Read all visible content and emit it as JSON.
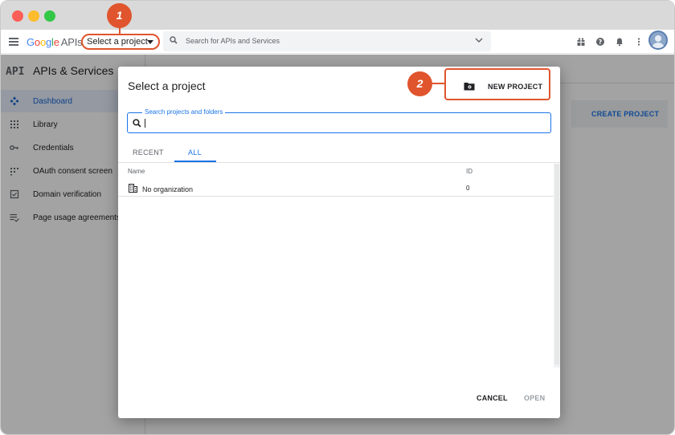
{
  "browser": {
    "traffic_lights": [
      "#fc5f57",
      "#fdbc2e",
      "#33c748"
    ]
  },
  "appbar": {
    "logo_letters": [
      "G",
      "o",
      "o",
      "g",
      "l",
      "e"
    ],
    "logo_suffix": "APIs",
    "project_select": "Select a project",
    "search_placeholder": "Search for APIs and Services",
    "icons": [
      "gift-icon",
      "help-icon",
      "bell-icon",
      "more-vert-icon"
    ]
  },
  "sidebar": {
    "api_badge": "API",
    "title": "APIs & Services",
    "items": [
      {
        "label": "Dashboard",
        "icon": "dashboard-icon",
        "active": true
      },
      {
        "label": "Library",
        "icon": "library-icon",
        "active": false
      },
      {
        "label": "Credentials",
        "icon": "key-icon",
        "active": false
      },
      {
        "label": "OAuth consent screen",
        "icon": "consent-icon",
        "active": false
      },
      {
        "label": "Domain verification",
        "icon": "verification-icon",
        "active": false
      },
      {
        "label": "Page usage agreements",
        "icon": "agreements-icon",
        "active": false
      }
    ]
  },
  "background": {
    "create_project": "CREATE PROJECT"
  },
  "dialog": {
    "title": "Select a project",
    "new_project": "NEW PROJECT",
    "search_label": "Search projects and folders",
    "tabs": [
      "RECENT",
      "ALL"
    ],
    "active_tab": "ALL",
    "columns": [
      "Name",
      "ID"
    ],
    "rows": [
      {
        "name": "No organization",
        "id": "0",
        "icon": "organization-icon"
      }
    ],
    "cancel": "CANCEL",
    "open": "OPEN"
  },
  "annotations": {
    "step1": "1",
    "step2": "2",
    "color": "#e0552d"
  },
  "colors": {
    "accent": "#1a73e8",
    "annotation": "#e0552d"
  }
}
